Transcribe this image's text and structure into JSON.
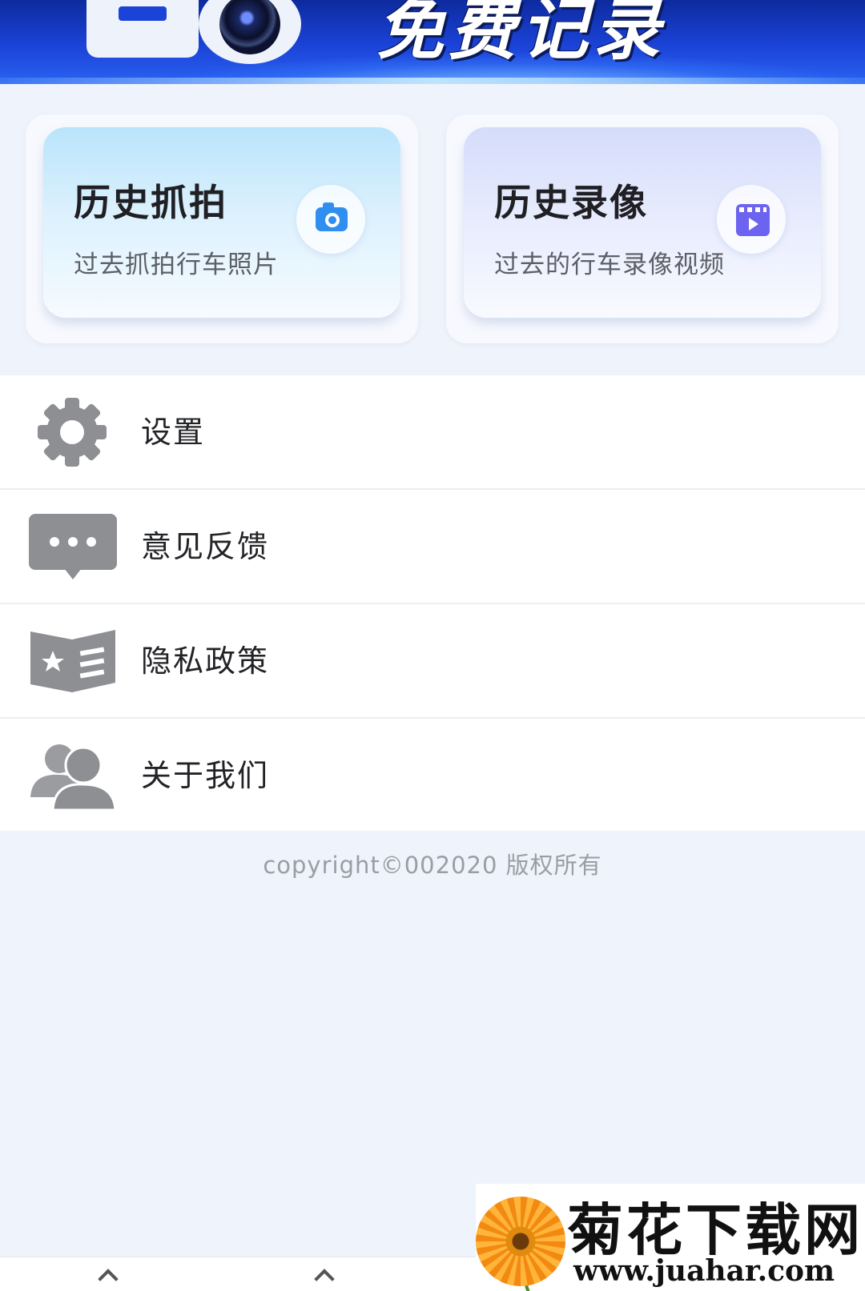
{
  "banner": {
    "title": "免费记录"
  },
  "cards": [
    {
      "title": "历史抓拍",
      "subtitle": "过去抓拍行车照片",
      "icon": "camera-icon",
      "accent": "#2f8ef0"
    },
    {
      "title": "历史录像",
      "subtitle": "过去的行车录像视频",
      "icon": "video-clip-icon",
      "accent": "#6c63f0"
    }
  ],
  "menu": {
    "items": [
      {
        "label": "设置",
        "icon": "gear-icon"
      },
      {
        "label": "意见反馈",
        "icon": "chat-bubble-icon"
      },
      {
        "label": "隐私政策",
        "icon": "policy-book-icon"
      },
      {
        "label": "关于我们",
        "icon": "users-icon"
      }
    ],
    "icon_color": "#8d8f93"
  },
  "footer": {
    "copyright": "copyright©002020 版权所有"
  },
  "watermark": {
    "title": "菊花下载网",
    "url": "www.juahar.com"
  }
}
